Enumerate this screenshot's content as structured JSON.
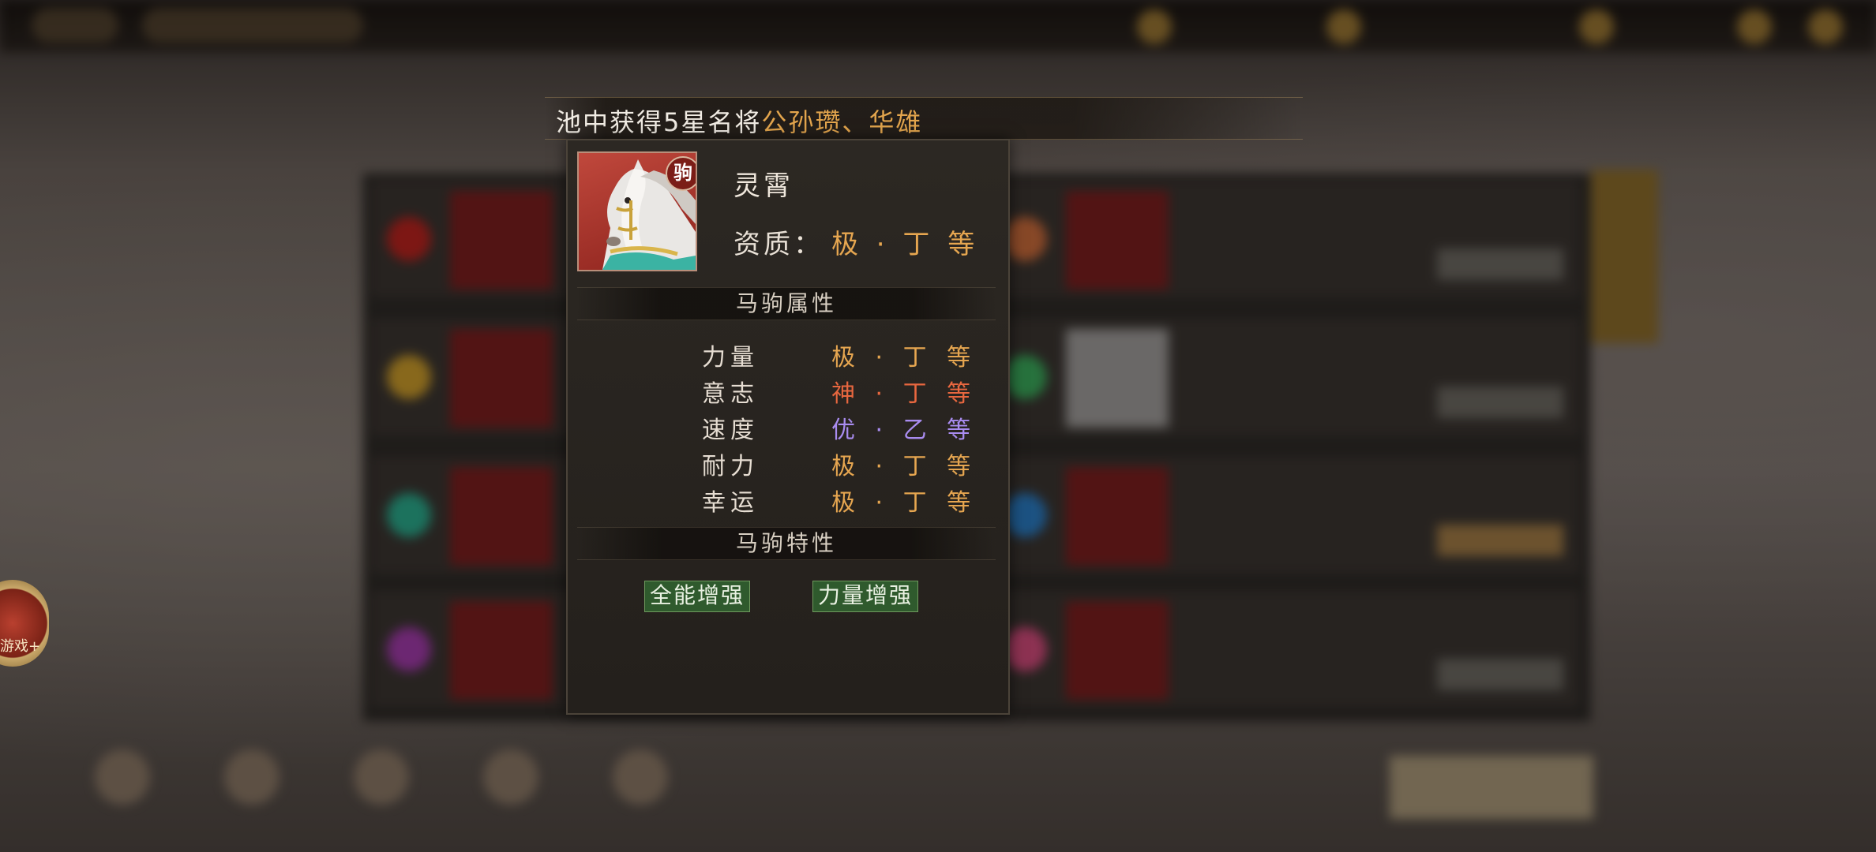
{
  "announcement": {
    "prefix": "池中获得5星名将",
    "highlight": "公孙瓒、华雄"
  },
  "horse": {
    "tag": "驹",
    "name": "灵霄",
    "quality_label": "资质：",
    "quality_value": "极 · 丁 等",
    "attributes_title": "马驹属性",
    "attributes": [
      {
        "label": "力量",
        "value": "极 · 丁 等",
        "color": "#e6a650"
      },
      {
        "label": "意志",
        "value": "神 · 丁 等",
        "color": "#e8673f"
      },
      {
        "label": "速度",
        "value": "优 · 乙 等",
        "color": "#a98cf0"
      },
      {
        "label": "耐力",
        "value": "极 · 丁 等",
        "color": "#e6a650"
      },
      {
        "label": "幸运",
        "value": "极 · 丁 等",
        "color": "#e6a650"
      }
    ],
    "traits_title": "马驹特性",
    "traits": [
      "全能增强",
      "力量增强"
    ]
  },
  "side_badge": {
    "text": "游戏+"
  }
}
